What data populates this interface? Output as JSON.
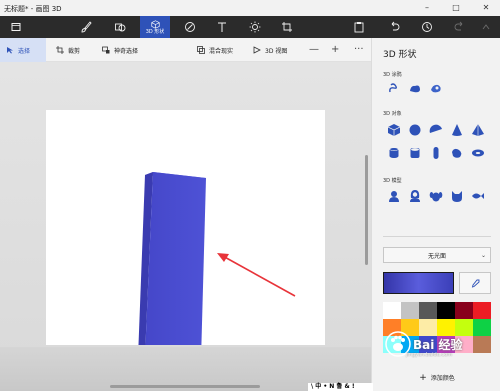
{
  "window": {
    "title": "无标题* - 画图 3D",
    "controls": [
      "minimize-icon",
      "maximize-icon",
      "close-icon"
    ]
  },
  "ribbon": {
    "tabs": [
      {
        "icon": "menu-icon",
        "label": ""
      },
      {
        "icon": "brushes-icon",
        "label": ""
      },
      {
        "icon": "2d-shapes-icon",
        "label": ""
      },
      {
        "icon": "3d-shapes-icon",
        "label": "3D 形状",
        "active": true
      },
      {
        "icon": "stickers-icon",
        "label": ""
      },
      {
        "icon": "text-icon",
        "label": ""
      },
      {
        "icon": "effects-icon",
        "label": ""
      },
      {
        "icon": "canvas-icon",
        "label": ""
      },
      {
        "icon": "3d-library-icon",
        "label": ""
      },
      {
        "icon": "paste-icon",
        "label": ""
      },
      {
        "icon": "undo-icon",
        "label": ""
      },
      {
        "icon": "history-icon",
        "label": ""
      },
      {
        "icon": "redo-icon",
        "label": ""
      },
      {
        "icon": "more-icon",
        "label": ""
      }
    ]
  },
  "toolbar": {
    "select": "选择",
    "crop": "裁剪",
    "magic_select": "神奇选择",
    "mixed_reality": "混合现实",
    "view_3d": "3D 视图",
    "zoom_out": "—",
    "zoom_in": "+",
    "more": "···"
  },
  "panel": {
    "title": "3D 形状",
    "sections": {
      "doodle": "3D 涂鸦",
      "objects": "3D 对象",
      "models": "3D 模型"
    },
    "material": "无光面",
    "add_color": "添加颜色",
    "selected_color": "#4547c9",
    "palette": [
      "#ffffff",
      "#c3c3c3",
      "#585858",
      "#000000",
      "#88001b",
      "#ec1c24",
      "#ff7f27",
      "#ffca18",
      "#fdeca6",
      "#fff200",
      "#c4ff0e",
      "#0ed145",
      "#8cfffb",
      "#00a8f3",
      "#3f48cc",
      "#b83dba",
      "#ffaec8",
      "#b97a56"
    ]
  },
  "watermark": {
    "text": "Bai 经验",
    "sub": "jingyan.baidu.com"
  },
  "footer_text": "\\ 中 • N 鲁 & !"
}
